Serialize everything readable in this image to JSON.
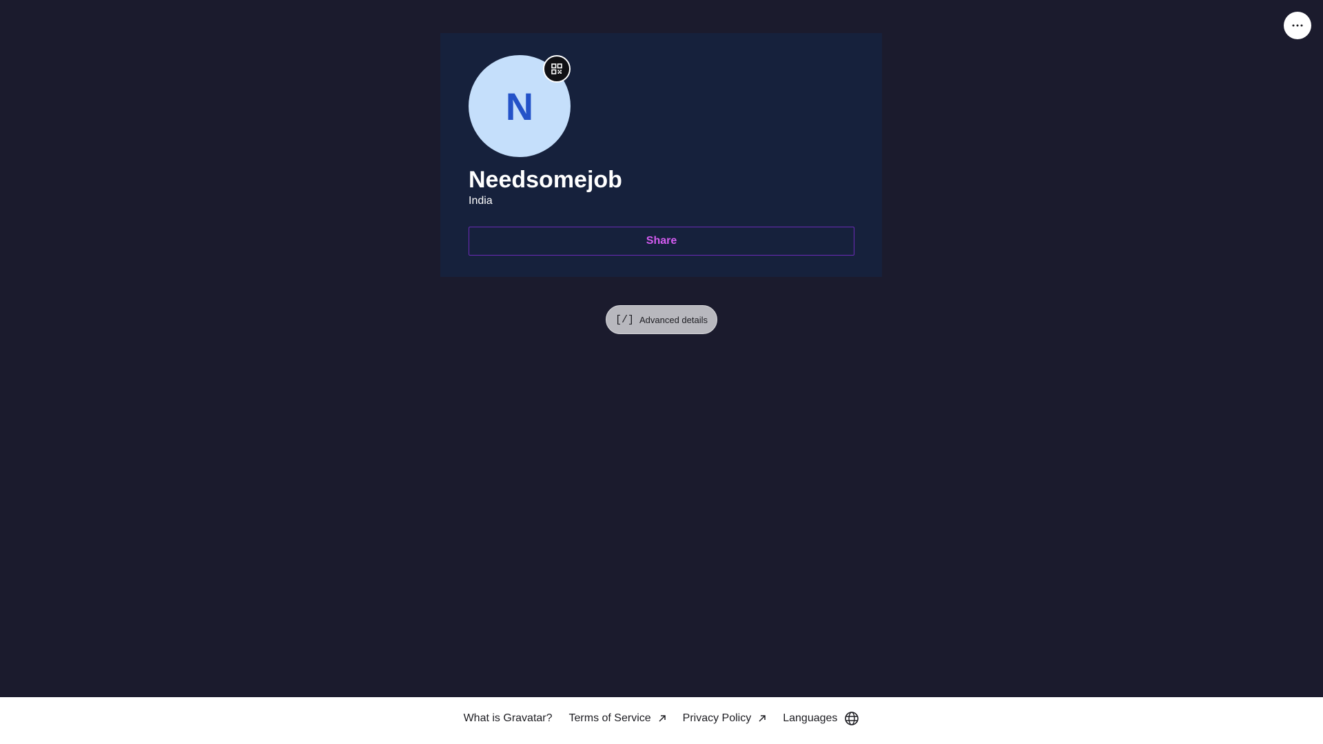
{
  "header": {
    "more_icon": "ellipsis-icon"
  },
  "profile": {
    "avatar_initial": "N",
    "avatar_bg": "#c5dffb",
    "avatar_text_color": "#2452c8",
    "qr_icon": "qr-code-icon",
    "display_name": "Needsomejob",
    "location": "India",
    "share_label": "Share",
    "share_color": "#d35bf0"
  },
  "advanced": {
    "icon_text": "[/]",
    "label": "Advanced details"
  },
  "footer": {
    "links": [
      {
        "label": "What is Gravatar?",
        "icon": ""
      },
      {
        "label": "Terms of Service",
        "icon": "external-arrow-icon"
      },
      {
        "label": "Privacy Policy",
        "icon": "external-arrow-icon"
      },
      {
        "label": "Languages",
        "icon": "globe-icon"
      }
    ]
  },
  "colors": {
    "page_bg": "#1b1b2d",
    "card_bg": "#16213c",
    "footer_bg": "#ffffff"
  }
}
